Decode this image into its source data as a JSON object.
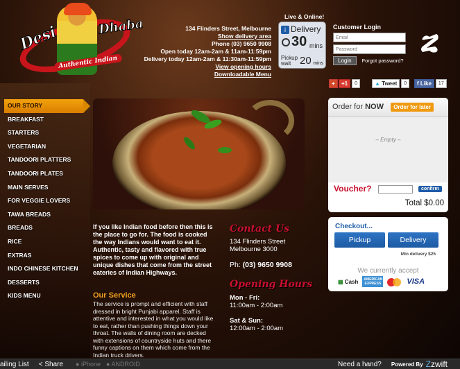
{
  "logo": {
    "word1": "Desi",
    "word2": "Dhaba",
    "subtitle": "Authentic Indian"
  },
  "address": {
    "street": "134 Flinders Street, Melbourne",
    "delivery_area_link": "Show delivery area",
    "phone": "Phone (03) 9650 9908",
    "open_today": "Open today 12am-2am & 11am-11:59pm",
    "delivery_today": "Delivery today 12am-2am & 11:30am-11:59pm",
    "hours_link": "View opening hours",
    "menu_link": "Downloadable Menu"
  },
  "wait_widget": {
    "live_label": "Live & Online!",
    "delivery_label": "Delivery",
    "delivery_minutes": "30",
    "delivery_unit": "mins",
    "pickup_label_1": "Pickup",
    "pickup_label_2": "wait",
    "pickup_minutes": "20",
    "pickup_unit": "mins"
  },
  "login": {
    "title": "Customer Login",
    "email_placeholder": "Email",
    "password_placeholder": "Password",
    "login_button": "Login",
    "forgot_link": "Forgot password?"
  },
  "social": {
    "gplus_label": "+1",
    "gplus_count": "0",
    "tweet_label": "Tweet",
    "tweet_count": "0",
    "like_label": "Like",
    "like_count": "17"
  },
  "nav": {
    "items": [
      "OUR STORY",
      "BREAKFAST",
      "STARTERS",
      "VEGETARIAN",
      "TANDOORI PLATTERS",
      "TANDOORI PLATES",
      "MAIN SERVES",
      "FOR VEGGIE LOVERS",
      "TAWA BREADS",
      "BREADS",
      "RICE",
      "EXTRAS",
      "INDO CHINESE KITCHEN",
      "DESSERTS",
      "KIDS MENU"
    ],
    "active_index": 0
  },
  "intro_text": "If you like Indian food before then this is the place to go for. The food is cooked the way Indians would want to eat it. Authentic, tasty and flavored with true spices to come up with original and unique dishes that come from the street eateries of Indian Highways.",
  "service": {
    "heading": "Our Service",
    "text": "The service is prompt and efficient with staff dressed in bright Punjabi apparel. Staff is attentive and interested in what you would like to eat, rather than pushing things down your throat. The walls of dining room are decked with extensions of countryside huts and there funny captions on them which come from the Indian truck drivers."
  },
  "contact": {
    "heading": "Contact Us",
    "line1": "134 Flinders Street",
    "line2": "Melbourne 3000",
    "phone_prefix": "Ph:",
    "phone": "(03) 9650 9908"
  },
  "hours": {
    "heading": "Opening Hours",
    "blocks": [
      {
        "days": "Mon - Fri:",
        "time": "11:00am - 2:00am"
      },
      {
        "days": "Sat & Sun:",
        "time": "12:00am - 2:00am"
      }
    ]
  },
  "order": {
    "title_prefix": "Order for",
    "title_strong": "NOW",
    "later_button": "Order for later",
    "empty_text": "– Empty –",
    "voucher_label": "Voucher?",
    "confirm_button": "confirm",
    "total": "Total $0.00"
  },
  "checkout": {
    "heading": "Checkout...",
    "pickup_button": "Pickup",
    "delivery_button": "Delivery",
    "min_delivery": "Min delivery $25",
    "accept_text": "We currently accept",
    "cash": "Cash",
    "amex": "AMERICAN EXPRESS",
    "visa": "VISA"
  },
  "footer": {
    "mailing_list": "ailing List",
    "share": "Share",
    "iphone": "iPhone",
    "android": "ANDROID",
    "help": "Need a hand?",
    "powered": "Powered By",
    "brand": "zwift"
  },
  "colors": {
    "accent_orange": "#f09a10",
    "brand_red": "#c8102e",
    "button_blue": "#1f5ca8"
  }
}
